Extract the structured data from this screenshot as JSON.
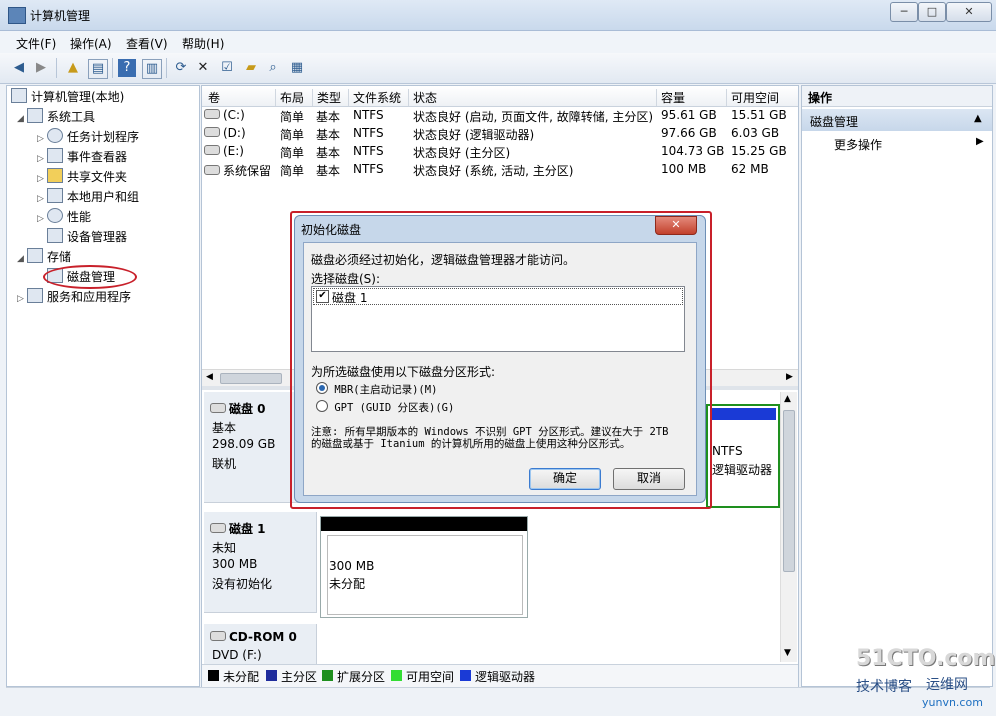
{
  "window": {
    "title": "计算机管理",
    "controls": {
      "minimize": "─",
      "maximize": "□",
      "close": "✕"
    }
  },
  "menu": [
    "文件(F)",
    "操作(A)",
    "查看(V)",
    "帮助(H)"
  ],
  "tree": {
    "root": "计算机管理(本地)",
    "system_tools": "系统工具",
    "task_scheduler": "任务计划程序",
    "event_viewer": "事件查看器",
    "shared_folders": "共享文件夹",
    "local_users": "本地用户和组",
    "performance": "性能",
    "device_manager": "设备管理器",
    "storage": "存储",
    "disk_management": "磁盘管理",
    "services_apps": "服务和应用程序"
  },
  "volume_list": {
    "headers": [
      "卷",
      "布局",
      "类型",
      "文件系统",
      "状态",
      "容量",
      "可用空间"
    ],
    "rows": [
      {
        "vol": "(C:)",
        "layout": "简单",
        "type": "基本",
        "fs": "NTFS",
        "status": "状态良好 (启动, 页面文件, 故障转储, 主分区)",
        "cap": "95.61 GB",
        "free": "15.51 GB"
      },
      {
        "vol": "(D:)",
        "layout": "简单",
        "type": "基本",
        "fs": "NTFS",
        "status": "状态良好 (逻辑驱动器)",
        "cap": "97.66 GB",
        "free": "6.03 GB"
      },
      {
        "vol": "(E:)",
        "layout": "简单",
        "type": "基本",
        "fs": "NTFS",
        "status": "状态良好 (主分区)",
        "cap": "104.73 GB",
        "free": "15.25 GB"
      },
      {
        "vol": "系统保留",
        "layout": "简单",
        "type": "基本",
        "fs": "NTFS",
        "status": "状态良好 (系统, 活动, 主分区)",
        "cap": "100 MB",
        "free": "62 MB"
      }
    ]
  },
  "disks": {
    "disk0": {
      "name": "磁盘 0",
      "kind": "基本",
      "size": "298.09 GB",
      "state": "联机",
      "partial_fs": "NTFS",
      "partial_status": "逻辑驱动器"
    },
    "disk1": {
      "name": "磁盘 1",
      "kind": "未知",
      "size": "300 MB",
      "state": "没有初始化",
      "part_size": "300 MB",
      "part_state": "未分配"
    },
    "cdrom": {
      "name": "CD-ROM 0",
      "kind": "DVD (F:)"
    }
  },
  "legend": [
    {
      "label": "未分配",
      "color": "#000000"
    },
    {
      "label": "主分区",
      "color": "#1f2c9c"
    },
    {
      "label": "扩展分区",
      "color": "#1e8f1e"
    },
    {
      "label": "可用空间",
      "color": "#33dd33"
    },
    {
      "label": "逻辑驱动器",
      "color": "#1a3ad6"
    }
  ],
  "actions": {
    "header": "操作",
    "section": "磁盘管理",
    "more": "更多操作"
  },
  "dialog": {
    "title": "初始化磁盘",
    "intro": "磁盘必须经过初始化，逻辑磁盘管理器才能访问。",
    "select_label": "选择磁盘(S):",
    "disks": [
      {
        "label": "磁盘 1",
        "checked": true
      }
    ],
    "style_label": "为所选磁盘使用以下磁盘分区形式:",
    "options": [
      {
        "label": "MBR(主启动记录)(M)",
        "selected": true
      },
      {
        "label": "GPT (GUID 分区表)(G)",
        "selected": false
      }
    ],
    "note": "注意: 所有早期版本的 Windows 不识别 GPT 分区形式。建议在大于 2TB 的磁盘或基于 Itanium 的计算机所用的磁盘上使用这种分区形式。",
    "ok": "确定",
    "cancel": "取消",
    "close": "✕"
  },
  "watermark": {
    "brand": "51CTO.com",
    "sub": "技术博客",
    "ops": "运维网",
    "site": "yunvn.com"
  },
  "colors": {
    "dialog_highlight": "#c8202a",
    "selection_blue": "#1a3ad6"
  }
}
